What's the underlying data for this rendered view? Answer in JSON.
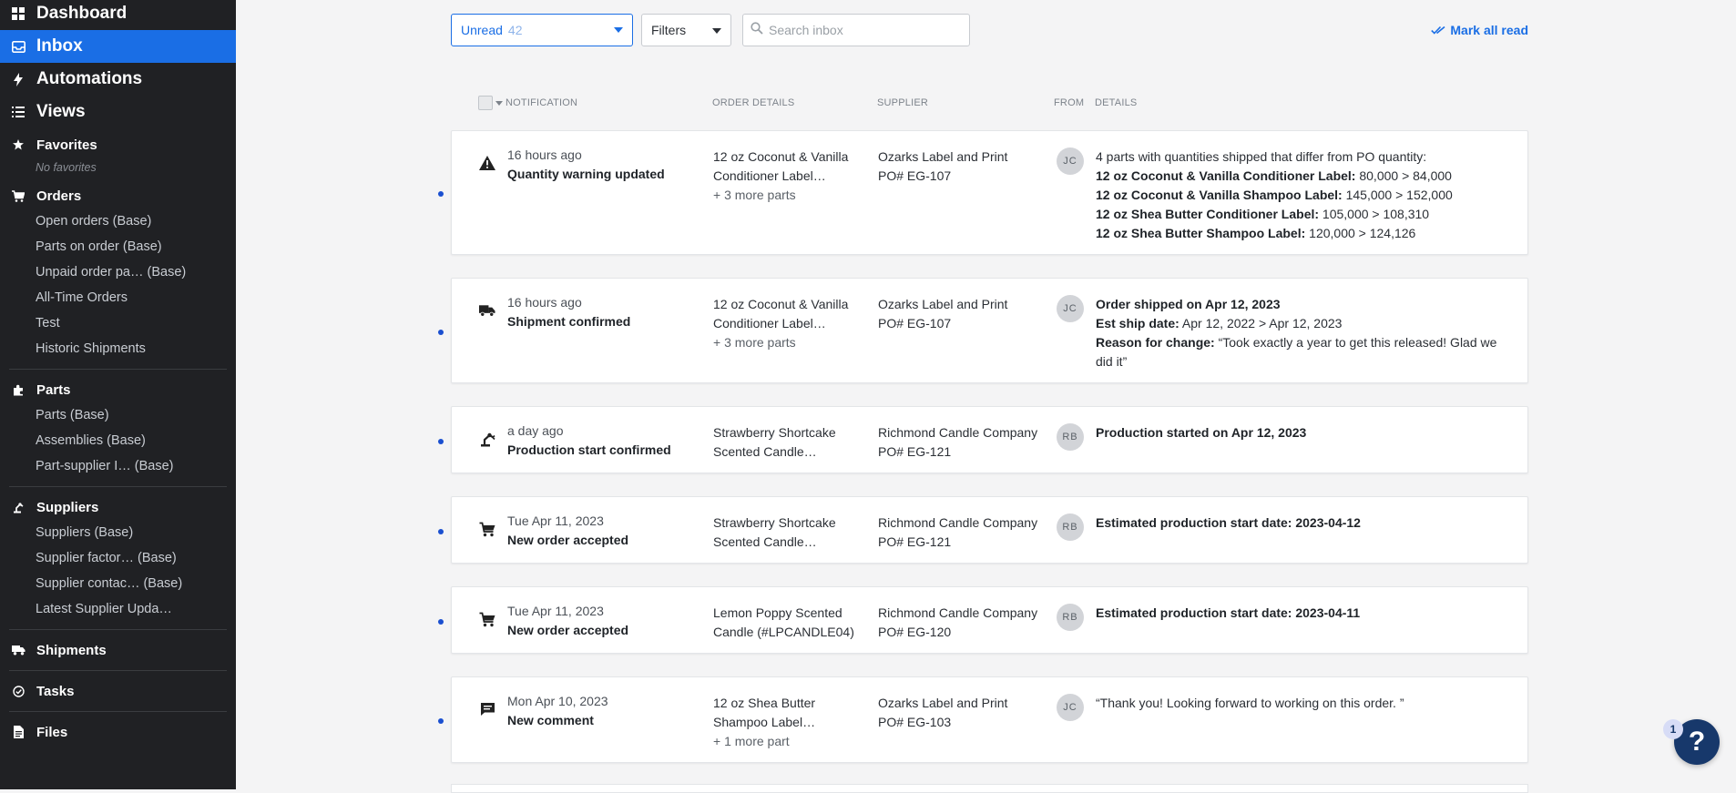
{
  "sidebar": {
    "dashboard": "Dashboard",
    "inbox": "Inbox",
    "automations": "Automations",
    "views": "Views",
    "favorites": {
      "label": "Favorites",
      "empty": "No favorites"
    },
    "orders": {
      "label": "Orders",
      "items": [
        "Open orders (Base)",
        "Parts on order (Base)",
        "Unpaid order pa… (Base)",
        "All-Time Orders",
        "Test",
        "Historic Shipments"
      ]
    },
    "parts": {
      "label": "Parts",
      "items": [
        "Parts (Base)",
        "Assemblies (Base)",
        "Part-supplier I… (Base)"
      ]
    },
    "suppliers": {
      "label": "Suppliers",
      "items": [
        "Suppliers (Base)",
        "Supplier factor… (Base)",
        "Supplier contac… (Base)",
        "Latest Supplier Upda…"
      ]
    },
    "shipments": "Shipments",
    "tasks": "Tasks",
    "files": "Files"
  },
  "toolbar": {
    "view_label": "Unread",
    "view_count": "42",
    "filters_label": "Filters",
    "search_placeholder": "Search inbox",
    "mark_all_read": "Mark all read"
  },
  "columns": {
    "notification": "NOTIFICATION",
    "order_details": "ORDER DETAILS",
    "supplier": "SUPPLIER",
    "from": "FROM",
    "details": "DETAILS"
  },
  "notifications": [
    {
      "icon": "warning-icon",
      "when": "16 hours ago",
      "title": "Quantity warning updated",
      "order_line1": "12 oz Coconut & Vanilla",
      "order_line2": "Conditioner Label…",
      "order_more": "+ 3 more parts",
      "supplier": "Ozarks Label and Print",
      "po": "PO# EG-107",
      "from": "JC",
      "details_intro": "4 parts with quantities shipped that differ from PO quantity:",
      "lines": [
        {
          "label": "12 oz Coconut & Vanilla Conditioner Label:",
          "value": " 80,000 > 84,000"
        },
        {
          "label": "12 oz Coconut & Vanilla Shampoo Label:",
          "value": " 145,000 > 152,000"
        },
        {
          "label": "12 oz Shea Butter Conditioner Label:",
          "value": " 105,000 > 108,310"
        },
        {
          "label": "12 oz Shea Butter Shampoo Label:",
          "value": " 120,000 > 124,126"
        }
      ]
    },
    {
      "icon": "truck-icon",
      "when": "16 hours ago",
      "title": "Shipment confirmed",
      "order_line1": "12 oz Coconut & Vanilla",
      "order_line2": "Conditioner Label…",
      "order_more": "+ 3 more parts",
      "supplier": "Ozarks Label and Print",
      "po": "PO# EG-107",
      "from": "JC",
      "headline": "Order shipped on Apr 12, 2023",
      "est_label": "Est ship date:",
      "est_value": " Apr 12, 2022 > Apr 12, 2023",
      "reason_label": "Reason for change:",
      "reason_value": " “Took exactly a year to get this released! Glad we did it”"
    },
    {
      "icon": "robot-arm-icon",
      "when": "a day ago",
      "title": "Production start confirmed",
      "order_line1": "Strawberry Shortcake",
      "order_line2": "Scented Candle…",
      "supplier": "Richmond Candle Company",
      "po": "PO# EG-121",
      "from": "RB",
      "headline": "Production started on Apr 12, 2023"
    },
    {
      "icon": "cart-icon",
      "when": "Tue Apr 11, 2023",
      "title": "New order accepted",
      "order_line1": "Strawberry Shortcake",
      "order_line2": "Scented Candle…",
      "supplier": "Richmond Candle Company",
      "po": "PO# EG-121",
      "from": "RB",
      "headline": "Estimated production start date: 2023-04-12"
    },
    {
      "icon": "cart-icon",
      "when": "Tue Apr 11, 2023",
      "title": "New order accepted",
      "order_line1": "Lemon Poppy Scented",
      "order_line2": "Candle (#LPCANDLE04)",
      "supplier": "Richmond Candle Company",
      "po": "PO# EG-120",
      "from": "RB",
      "headline": "Estimated production start date: 2023-04-11"
    },
    {
      "icon": "comment-icon",
      "when": "Mon Apr 10, 2023",
      "title": "New comment",
      "order_line1": "12 oz Shea Butter",
      "order_line2": "Shampoo Label…",
      "order_more": "+ 1 more part",
      "supplier": "Ozarks Label and Print",
      "po": "PO# EG-103",
      "from": "JC",
      "comment": "“Thank you! Looking forward to working on this order. ”"
    }
  ],
  "help": {
    "glyph": "?",
    "badge": "1"
  },
  "colors": {
    "accent": "#1a6ee5",
    "sidebar_bg": "#202124",
    "unread_dot": "#1a4fd0",
    "help_bg": "#17386b"
  }
}
